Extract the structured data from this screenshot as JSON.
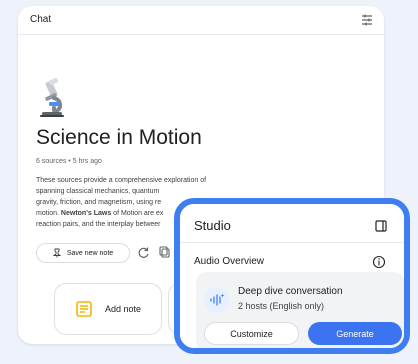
{
  "chat": {
    "title": "Chat",
    "notebook_title": "Science in Motion",
    "meta": "6 sources • 5 hrs ago",
    "summary_lines": [
      "These sources provide a comprehensive exploration of",
      "spanning classical mechanics, quantum",
      "gravity, friction, and magnetism, using re",
      "motion.",
      "Newton's Laws",
      "of Motion are ex",
      "reaction pairs, and the interplay betweer"
    ],
    "save_note_label": "Save new note",
    "add_note_label": "Add note"
  },
  "studio": {
    "title": "Studio",
    "audio_overview": "Audio Overview",
    "card_title": "Deep dive conversation",
    "card_subtitle": "2 hosts (English only)",
    "customize_label": "Customize",
    "generate_label": "Generate"
  },
  "colors": {
    "accent": "#3F7EF0",
    "background": "#EEF3FB",
    "card": "#F1F3F4"
  },
  "icons": {
    "tune": "tune-icon",
    "microscope": "microscope-icon",
    "pin": "pin-icon",
    "refresh": "refresh-icon",
    "copy": "copy-icon",
    "thumb_up": "thumb-up-icon",
    "note": "note-icon",
    "audio_wave": "audio-wave-icon",
    "panel": "panel-icon",
    "info": "info-icon"
  }
}
